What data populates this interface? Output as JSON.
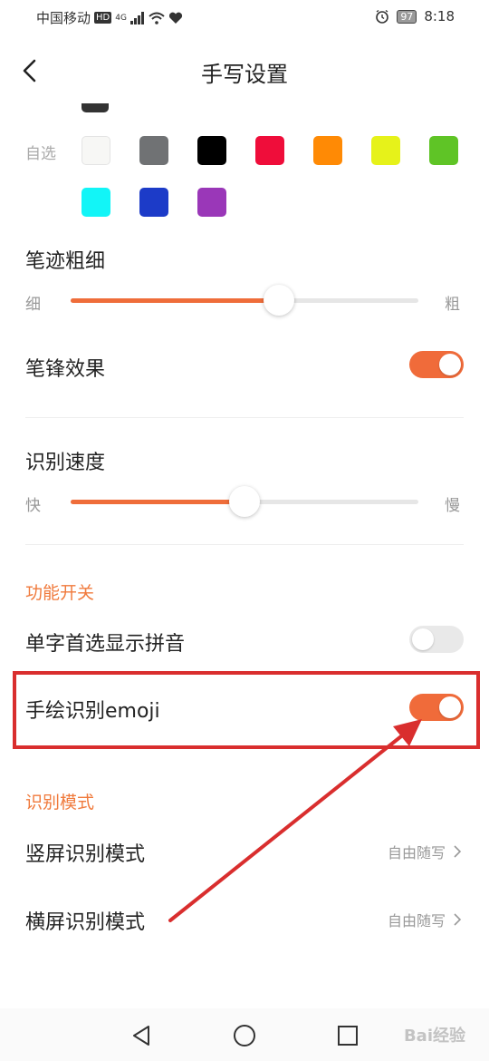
{
  "status_bar": {
    "carrier": "中国移动",
    "hd": "HD",
    "network": "4G",
    "battery": "97",
    "time": "8:18"
  },
  "header": {
    "title": "手写设置"
  },
  "colors": {
    "label": "自选",
    "swatches": [
      {
        "name": "white",
        "hex": "#f7f7f5"
      },
      {
        "name": "gray",
        "hex": "#707274"
      },
      {
        "name": "black",
        "hex": "#000000"
      },
      {
        "name": "red",
        "hex": "#ef0d3a"
      },
      {
        "name": "orange",
        "hex": "#ff8a05"
      },
      {
        "name": "yellow",
        "hex": "#e6f21a"
      },
      {
        "name": "green",
        "hex": "#5fc426"
      },
      {
        "name": "cyan",
        "hex": "#12f5f7"
      },
      {
        "name": "blue",
        "hex": "#1c3bc8"
      },
      {
        "name": "purple",
        "hex": "#9a37b8"
      }
    ]
  },
  "stroke_width": {
    "title": "笔迹粗细",
    "min_label": "细",
    "max_label": "粗",
    "value": 0.6
  },
  "pen_tip": {
    "label": "笔锋效果",
    "on": true
  },
  "recognition_speed": {
    "title": "识别速度",
    "min_label": "快",
    "max_label": "慢",
    "value": 0.5
  },
  "features": {
    "heading": "功能开关",
    "pinyin": {
      "label": "单字首选显示拼音",
      "on": false
    },
    "emoji": {
      "label": "手绘识别emoji",
      "on": true
    }
  },
  "recognition_mode": {
    "heading": "识别模式",
    "portrait": {
      "label": "竖屏识别模式",
      "value": "自由随写"
    },
    "landscape": {
      "label": "横屏识别模式",
      "value": "自由随写"
    }
  },
  "annotation": {
    "color": "#d92e2e"
  },
  "watermark": "Bai经验"
}
